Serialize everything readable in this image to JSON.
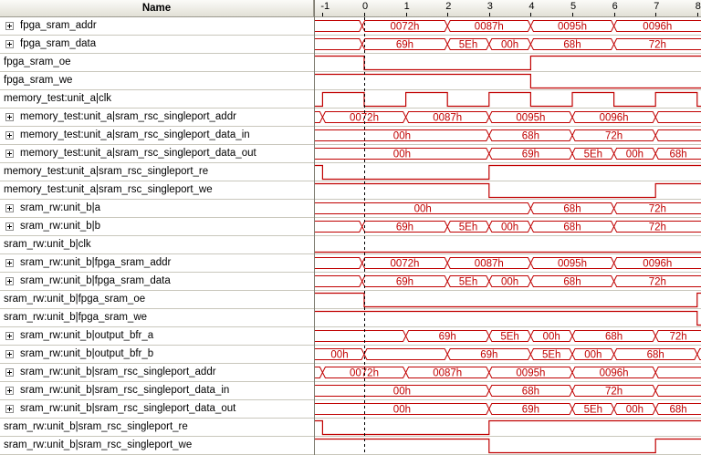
{
  "header": {
    "name_label": "Name",
    "time_ticks": [
      "-1",
      "0",
      "1",
      "2",
      "3",
      "4",
      "5",
      "6",
      "7",
      "8"
    ]
  },
  "colors": {
    "wave": "#c00000",
    "cursor": "#000000",
    "grid": "#c9c7bc"
  },
  "signals": [
    {
      "name": "fpga_sram_addr",
      "expandable": true,
      "kind": "bus",
      "segments": [
        [
          -1.6,
          -0.05,
          ""
        ],
        [
          -0.05,
          2.0,
          "0072h"
        ],
        [
          2.0,
          4.0,
          "0087h"
        ],
        [
          4.0,
          6.0,
          "0095h"
        ],
        [
          6.0,
          8.2,
          "0096h"
        ]
      ]
    },
    {
      "name": "fpga_sram_data",
      "expandable": true,
      "kind": "bus",
      "segments": [
        [
          -1.6,
          -0.05,
          ""
        ],
        [
          -0.05,
          2.0,
          "69h"
        ],
        [
          2.0,
          3.0,
          "5Eh"
        ],
        [
          3.0,
          4.0,
          "00h"
        ],
        [
          4.0,
          6.0,
          "68h"
        ],
        [
          6.0,
          8.2,
          "72h"
        ]
      ]
    },
    {
      "name": "fpga_sram_oe",
      "expandable": false,
      "kind": "bit",
      "transitions": [
        [
          -1.6,
          1
        ],
        [
          0,
          0
        ],
        [
          4,
          1
        ]
      ]
    },
    {
      "name": "fpga_sram_we",
      "expandable": false,
      "kind": "bit",
      "transitions": [
        [
          -1.6,
          1
        ],
        [
          4,
          0
        ]
      ]
    },
    {
      "name": "memory_test:unit_a|clk",
      "expandable": false,
      "kind": "clock",
      "transitions": [
        [
          -1.6,
          0
        ],
        [
          -1,
          1
        ],
        [
          0,
          0
        ],
        [
          1,
          1
        ],
        [
          2,
          0
        ],
        [
          3,
          1
        ],
        [
          4,
          0
        ],
        [
          5,
          1
        ],
        [
          6,
          0
        ],
        [
          7,
          1
        ],
        [
          8,
          0
        ]
      ]
    },
    {
      "name": "memory_test:unit_a|sram_rsc_singleport_addr",
      "expandable": true,
      "kind": "bus",
      "segments": [
        [
          -1.6,
          -1.0,
          ""
        ],
        [
          -1.0,
          1.0,
          "0072h"
        ],
        [
          1.0,
          3.0,
          "0087h"
        ],
        [
          3.0,
          5.0,
          "0095h"
        ],
        [
          5.0,
          7.0,
          "0096h"
        ],
        [
          7.0,
          8.2,
          ""
        ]
      ]
    },
    {
      "name": "memory_test:unit_a|sram_rsc_singleport_data_in",
      "expandable": true,
      "kind": "bus",
      "segments": [
        [
          -1.6,
          3.0,
          "00h"
        ],
        [
          3.0,
          5.0,
          "68h"
        ],
        [
          5.0,
          7.0,
          "72h"
        ],
        [
          7.0,
          8.2,
          ""
        ]
      ]
    },
    {
      "name": "memory_test:unit_a|sram_rsc_singleport_data_out",
      "expandable": true,
      "kind": "bus",
      "segments": [
        [
          -1.6,
          3.0,
          "00h"
        ],
        [
          3.0,
          5.0,
          "69h"
        ],
        [
          5.0,
          6.0,
          "5Eh"
        ],
        [
          6.0,
          7.0,
          "00h"
        ],
        [
          7.0,
          8.2,
          "68h"
        ]
      ]
    },
    {
      "name": "memory_test:unit_a|sram_rsc_singleport_re",
      "expandable": false,
      "kind": "bit",
      "transitions": [
        [
          -1.6,
          1
        ],
        [
          -1,
          0
        ],
        [
          3,
          1
        ]
      ]
    },
    {
      "name": "memory_test:unit_a|sram_rsc_singleport_we",
      "expandable": false,
      "kind": "bit",
      "transitions": [
        [
          -1.6,
          1
        ],
        [
          3,
          0
        ],
        [
          7,
          1
        ]
      ]
    },
    {
      "name": "sram_rw:unit_b|a",
      "expandable": true,
      "kind": "bus",
      "segments": [
        [
          -1.6,
          4.0,
          "00h"
        ],
        [
          4.0,
          6.0,
          "68h"
        ],
        [
          6.0,
          8.2,
          "72h"
        ]
      ]
    },
    {
      "name": "sram_rw:unit_b|b",
      "expandable": true,
      "kind": "bus",
      "segments": [
        [
          -1.6,
          -0.05,
          ""
        ],
        [
          -0.05,
          2.0,
          "69h"
        ],
        [
          2.0,
          3.0,
          "5Eh"
        ],
        [
          3.0,
          4.0,
          "00h"
        ],
        [
          4.0,
          6.0,
          "68h"
        ],
        [
          6.0,
          8.2,
          "72h"
        ]
      ]
    },
    {
      "name": "sram_rw:unit_b|clk",
      "expandable": false,
      "kind": "bit",
      "transitions": [
        [
          -1.6,
          0
        ]
      ]
    },
    {
      "name": "sram_rw:unit_b|fpga_sram_addr",
      "expandable": true,
      "kind": "bus",
      "segments": [
        [
          -1.6,
          -0.05,
          ""
        ],
        [
          -0.05,
          2.0,
          "0072h"
        ],
        [
          2.0,
          4.0,
          "0087h"
        ],
        [
          4.0,
          6.0,
          "0095h"
        ],
        [
          6.0,
          8.2,
          "0096h"
        ]
      ]
    },
    {
      "name": "sram_rw:unit_b|fpga_sram_data",
      "expandable": true,
      "kind": "bus",
      "segments": [
        [
          -1.6,
          -0.05,
          ""
        ],
        [
          -0.05,
          2.0,
          "69h"
        ],
        [
          2.0,
          3.0,
          "5Eh"
        ],
        [
          3.0,
          4.0,
          "00h"
        ],
        [
          4.0,
          6.0,
          "68h"
        ],
        [
          6.0,
          8.2,
          "72h"
        ]
      ]
    },
    {
      "name": "sram_rw:unit_b|fpga_sram_oe",
      "expandable": false,
      "kind": "bit",
      "transitions": [
        [
          -1.6,
          1
        ],
        [
          0,
          0
        ],
        [
          8,
          1
        ]
      ]
    },
    {
      "name": "sram_rw:unit_b|fpga_sram_we",
      "expandable": false,
      "kind": "bit",
      "transitions": [
        [
          -1.6,
          1
        ],
        [
          8,
          0
        ]
      ]
    },
    {
      "name": "sram_rw:unit_b|output_bfr_a",
      "expandable": true,
      "kind": "bus",
      "segments": [
        [
          -1.6,
          1.0,
          ""
        ],
        [
          1.0,
          3.0,
          "69h"
        ],
        [
          3.0,
          4.0,
          "5Eh"
        ],
        [
          4.0,
          5.0,
          "00h"
        ],
        [
          5.0,
          7.0,
          "68h"
        ],
        [
          7.0,
          8.2,
          "72h"
        ]
      ]
    },
    {
      "name": "sram_rw:unit_b|output_bfr_b",
      "expandable": true,
      "kind": "bus",
      "segments": [
        [
          -1.6,
          0.0,
          "00h"
        ],
        [
          0.0,
          2.0,
          ""
        ],
        [
          2.0,
          4.0,
          "69h"
        ],
        [
          4.0,
          5.0,
          "5Eh"
        ],
        [
          5.0,
          6.0,
          "00h"
        ],
        [
          6.0,
          8.0,
          "68h"
        ],
        [
          8.0,
          8.2,
          ""
        ]
      ]
    },
    {
      "name": "sram_rw:unit_b|sram_rsc_singleport_addr",
      "expandable": true,
      "kind": "bus",
      "segments": [
        [
          -1.6,
          -1.0,
          ""
        ],
        [
          -1.0,
          1.0,
          "0072h"
        ],
        [
          1.0,
          3.0,
          "0087h"
        ],
        [
          3.0,
          5.0,
          "0095h"
        ],
        [
          5.0,
          7.0,
          "0096h"
        ],
        [
          7.0,
          8.2,
          ""
        ]
      ]
    },
    {
      "name": "sram_rw:unit_b|sram_rsc_singleport_data_in",
      "expandable": true,
      "kind": "bus",
      "segments": [
        [
          -1.6,
          3.0,
          "00h"
        ],
        [
          3.0,
          5.0,
          "68h"
        ],
        [
          5.0,
          7.0,
          "72h"
        ],
        [
          7.0,
          8.2,
          ""
        ]
      ]
    },
    {
      "name": "sram_rw:unit_b|sram_rsc_singleport_data_out",
      "expandable": true,
      "kind": "bus",
      "segments": [
        [
          -1.6,
          3.0,
          "00h"
        ],
        [
          3.0,
          5.0,
          "69h"
        ],
        [
          5.0,
          6.0,
          "5Eh"
        ],
        [
          6.0,
          7.0,
          "00h"
        ],
        [
          7.0,
          8.2,
          "68h"
        ]
      ]
    },
    {
      "name": "sram_rw:unit_b|sram_rsc_singleport_re",
      "expandable": false,
      "kind": "bit",
      "transitions": [
        [
          -1.6,
          1
        ],
        [
          -1,
          0
        ],
        [
          3,
          1
        ]
      ]
    },
    {
      "name": "sram_rw:unit_b|sram_rsc_singleport_we",
      "expandable": false,
      "kind": "bit",
      "transitions": [
        [
          -1.6,
          1
        ],
        [
          3,
          0
        ],
        [
          7,
          1
        ]
      ]
    }
  ]
}
